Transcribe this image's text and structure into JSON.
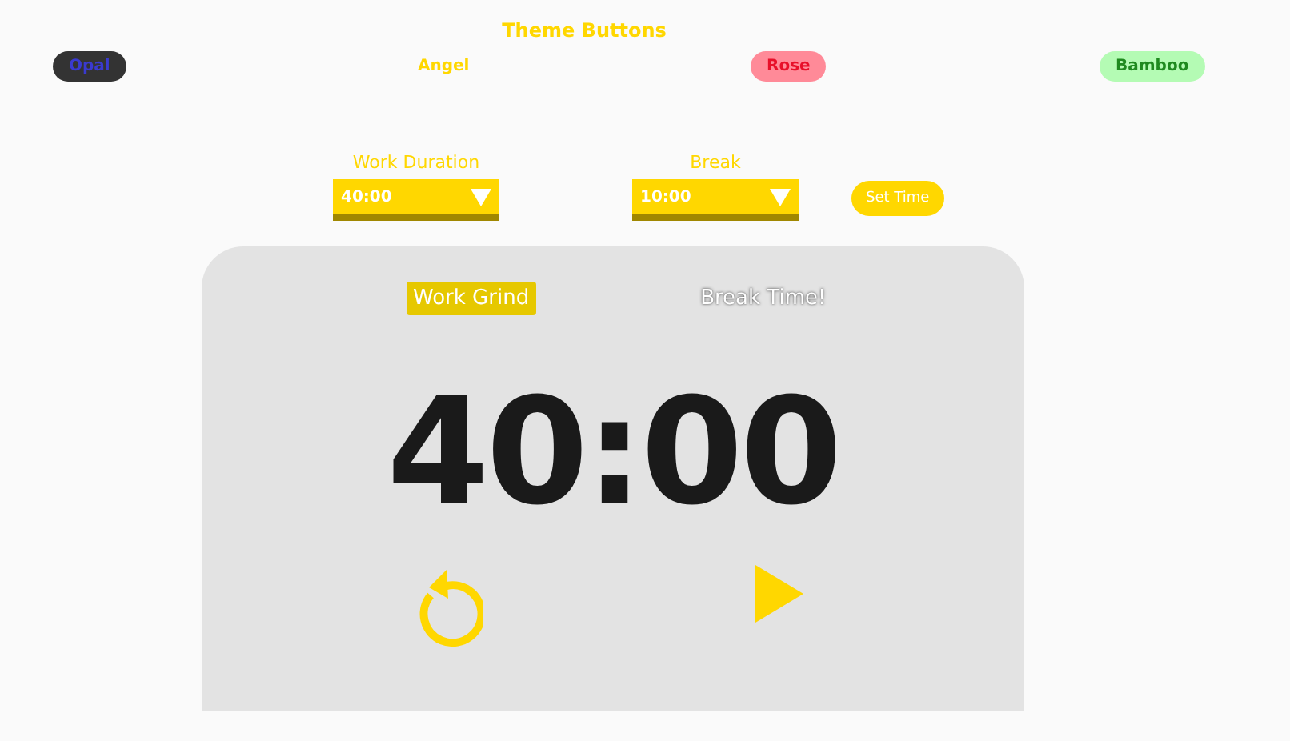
{
  "themes_title": "Theme Buttons",
  "themes": [
    {
      "kind": "opal",
      "label": "Opal"
    },
    {
      "kind": "angel",
      "label": "Angel"
    },
    {
      "kind": "rose",
      "label": "Rose"
    },
    {
      "kind": "bamboo",
      "label": "Bamboo"
    }
  ],
  "settings": {
    "work": {
      "label": "Work Duration",
      "value": "40:00"
    },
    "break": {
      "label": "Break",
      "value": "10:00"
    },
    "set_button": "Set Time"
  },
  "timer": {
    "modes": [
      {
        "label": "Work Grind",
        "selected": true
      },
      {
        "label": "Break Time!",
        "selected": false
      }
    ],
    "display": "40:00"
  }
}
